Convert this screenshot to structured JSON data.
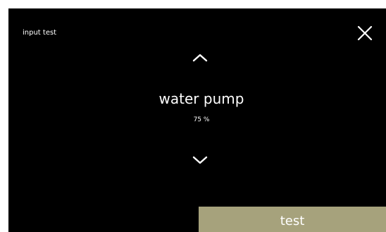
{
  "screen": {
    "title": "input test",
    "item": {
      "name": "water pump",
      "value": "75 %"
    },
    "close_icon": "close-icon",
    "up_icon": "chevron-up-icon",
    "down_icon": "chevron-down-icon",
    "test_button": {
      "label": "test"
    }
  },
  "colors": {
    "background": "#000000",
    "text": "#ffffff",
    "accent": "#a6a27c"
  }
}
